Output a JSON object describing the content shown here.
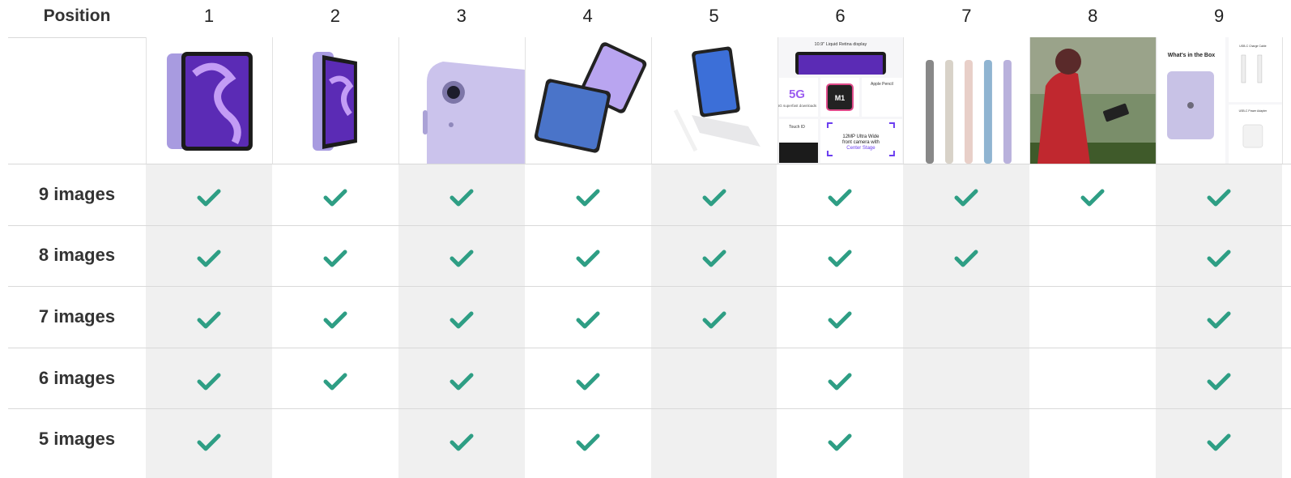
{
  "header": {
    "corner_label": "Position",
    "positions": [
      "1",
      "2",
      "3",
      "4",
      "5",
      "6",
      "7",
      "8",
      "9"
    ]
  },
  "thumbnails": [
    {
      "icon": "ipad-front-purple-image"
    },
    {
      "icon": "ipad-angled-purple-image"
    },
    {
      "icon": "ipad-back-camera-closeup-image"
    },
    {
      "icon": "ipad-gaming-two-devices-image"
    },
    {
      "icon": "ipad-magic-keyboard-pencil-image"
    },
    {
      "icon": "ipad-features-collage-image",
      "texts": {
        "display": "10.9\" Liquid Retina display",
        "fiveg": "5G",
        "fiveg_sub": "5G superfast downloads",
        "chip": "M1",
        "pencil": "Apple Pencil",
        "touchid": "Touch ID",
        "camera_l1": "12MP Ultra Wide",
        "camera_l2": "front camera with",
        "camera_l3": "Center Stage"
      }
    },
    {
      "icon": "ipad-color-lineup-side-image"
    },
    {
      "icon": "person-using-ipad-photo"
    },
    {
      "icon": "whats-in-the-box-image",
      "texts": {
        "title": "What's in the Box",
        "cable": "USB-C Charge Cable",
        "adapter": "USB-C Power Adapter"
      }
    }
  ],
  "rows": [
    {
      "label": "9 images",
      "checks": [
        true,
        true,
        true,
        true,
        true,
        true,
        true,
        true,
        true
      ]
    },
    {
      "label": "8 images",
      "checks": [
        true,
        true,
        true,
        true,
        true,
        true,
        true,
        false,
        true
      ]
    },
    {
      "label": "7 images",
      "checks": [
        true,
        true,
        true,
        true,
        true,
        true,
        false,
        false,
        true
      ]
    },
    {
      "label": "6 images",
      "checks": [
        true,
        true,
        true,
        true,
        false,
        true,
        false,
        false,
        true
      ]
    },
    {
      "label": "5 images",
      "checks": [
        true,
        false,
        true,
        true,
        false,
        true,
        false,
        false,
        true
      ]
    }
  ],
  "colors": {
    "check": "#2e9e84",
    "shaded_column": "#f0f0f0",
    "ipad_purple": "#a89be0",
    "screen_purple": "#5b2bb5"
  }
}
